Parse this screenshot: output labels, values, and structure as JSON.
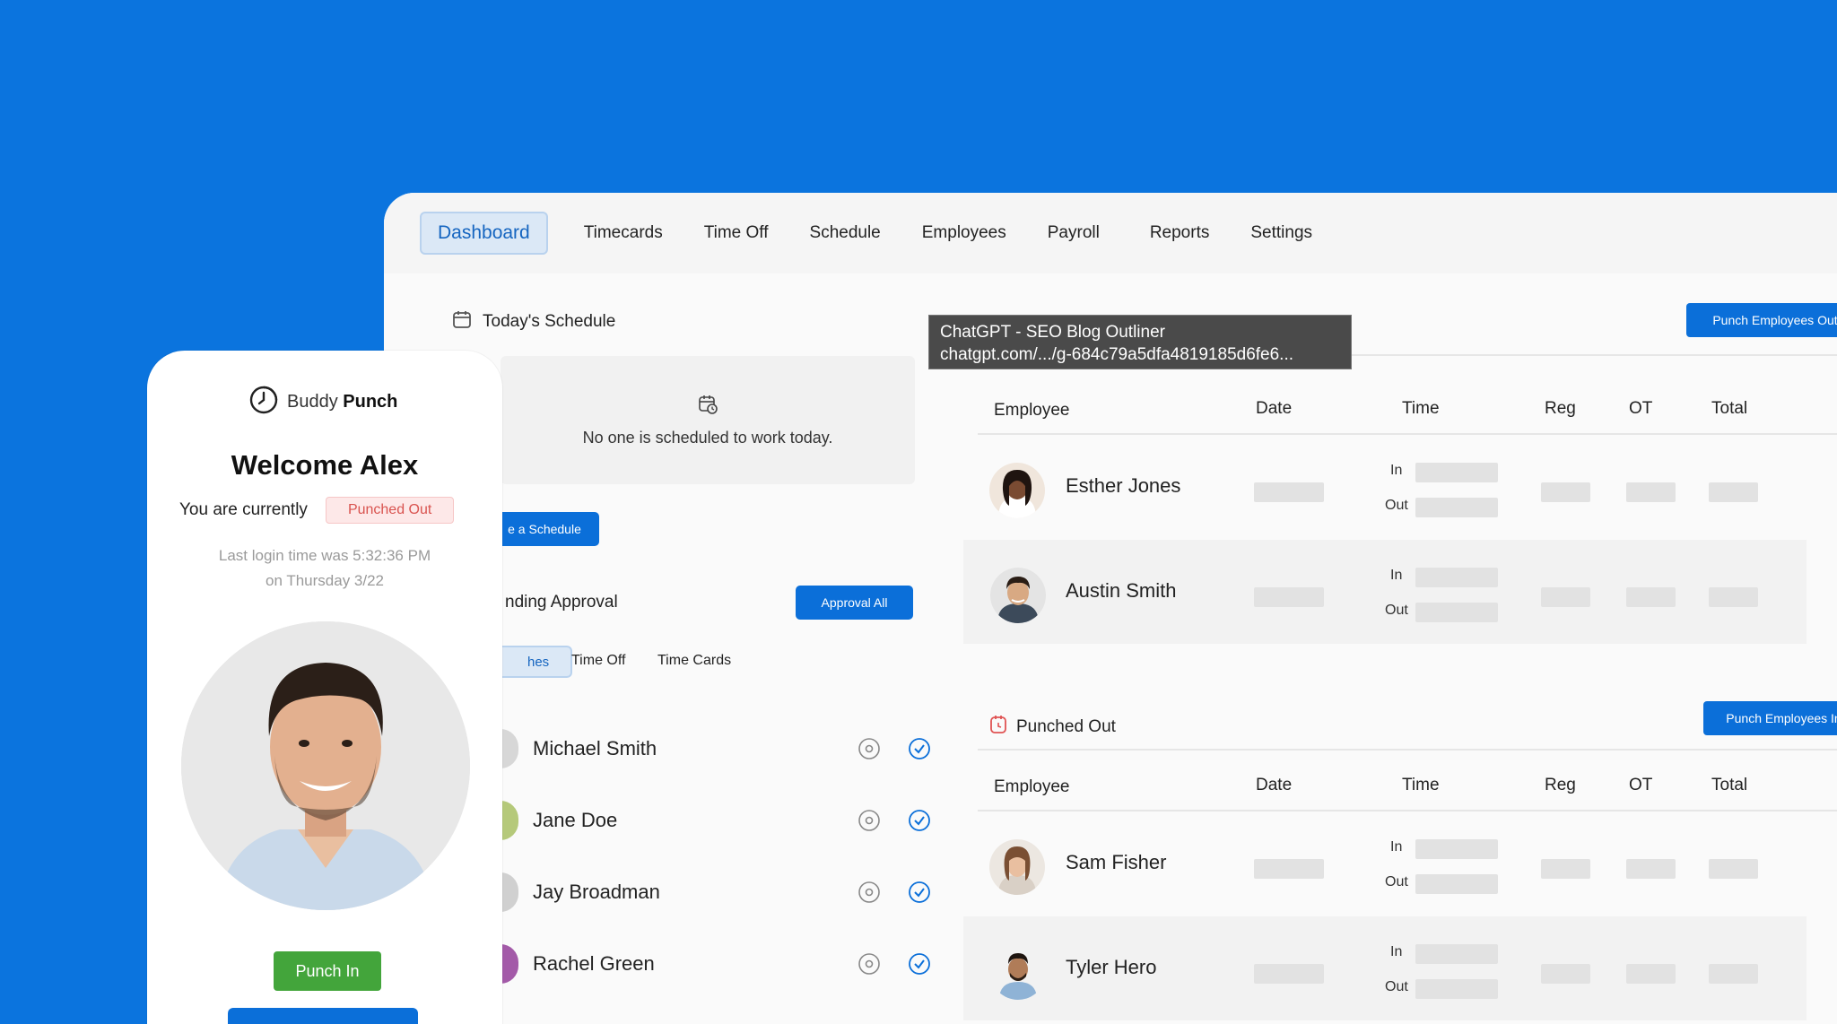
{
  "nav": {
    "items": [
      "Dashboard",
      "Timecards",
      "Time Off",
      "Schedule",
      "Employees",
      "Payroll",
      "Reports",
      "Settings"
    ],
    "active": "Dashboard"
  },
  "schedule": {
    "title": "Today's Schedule",
    "empty_message": "No one is scheduled to work today.",
    "add_button": "e a Schedule"
  },
  "approval": {
    "title": "nding Approval",
    "approve_all": "Approval All",
    "tabs": [
      "hes",
      "Time Off",
      "Time Cards"
    ],
    "rows": [
      "Michael Smith",
      "Jane Doe",
      "Jay Broadman",
      "Rachel Green"
    ]
  },
  "tooltip": {
    "line1": "ChatGPT - SEO Blog Outliner",
    "line2": "chatgpt.com/.../g-684c79a5dfa4819185d6fe6..."
  },
  "punched_in": {
    "button": "Punch Employees Out",
    "columns": [
      "Employee",
      "Date",
      "Time",
      "Reg",
      "OT",
      "Total"
    ],
    "employees": [
      "Esther Jones",
      "Austin Smith"
    ]
  },
  "punched_out": {
    "title": "Punched Out",
    "button": "Punch Employees In",
    "columns": [
      "Employee",
      "Date",
      "Time",
      "Reg",
      "OT",
      "Total"
    ],
    "employees": [
      "Sam Fisher",
      "Tyler Hero"
    ]
  },
  "time_labels": {
    "in": "In",
    "out": "Out"
  },
  "mobile": {
    "brand_light": "Buddy",
    "brand_bold": "Punch",
    "welcome": "Welcome Alex",
    "status_label": "You are currently",
    "status_value": "Punched Out",
    "login_line1": "Last login time was 5:32:36 PM",
    "login_line2": "on Thursday 3/22",
    "punch_in": "Punch In"
  },
  "colors": {
    "background": "#0b74de",
    "primary": "#0b6fd9",
    "success": "#43a53b",
    "danger": "#d9534f"
  }
}
